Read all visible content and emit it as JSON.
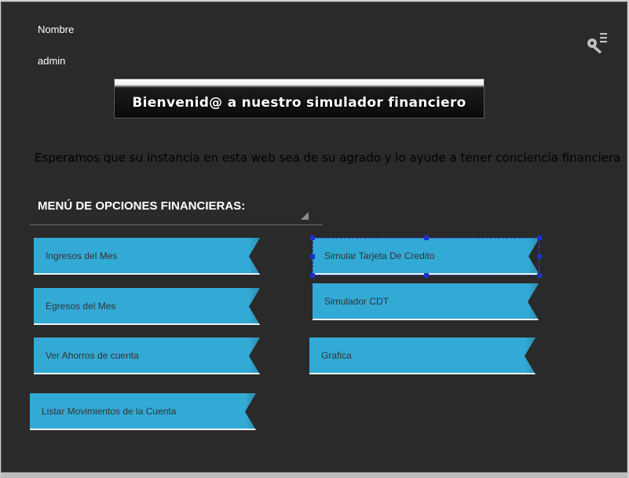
{
  "user": {
    "label": "Nombre",
    "value": "admin"
  },
  "header": {
    "icon": "key-menu-icon"
  },
  "banner": {
    "title": "Bienvenid@ a nuestro simulador financiero"
  },
  "subtitle": "Esperamos que su instancia en esta web sea de su agrado y lo ayude a tener conciencia financiera",
  "menu": {
    "heading": "MENÚ DE OPCIONES FINANCIERAS:",
    "items": [
      {
        "label": "Ingresos del Mes"
      },
      {
        "label": "Egresos del Mes"
      },
      {
        "label": "Ver Ahorros de cuenta"
      },
      {
        "label": "Listar Movimientos de la Cuenta"
      },
      {
        "label": "Simular Tarjeta De Credito"
      },
      {
        "label": "Simulador CDT"
      },
      {
        "label": "Grafica"
      }
    ]
  },
  "colors": {
    "background": "#2a2a2a",
    "ribbon": "#33aad6",
    "selection": "#1d2fd0"
  }
}
